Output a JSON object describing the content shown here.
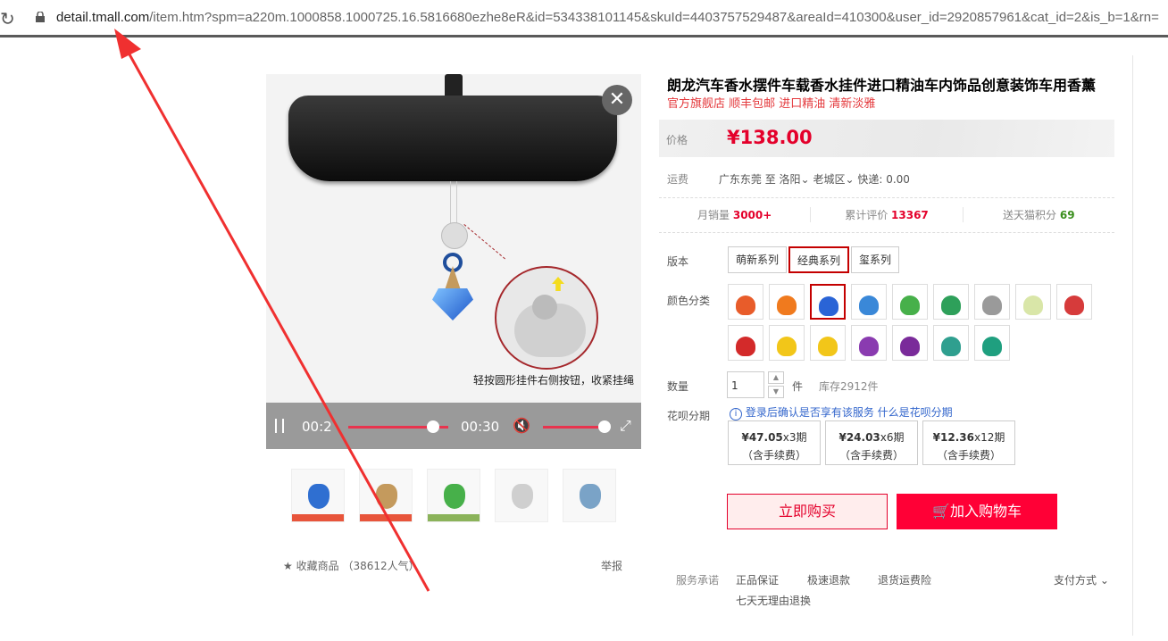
{
  "browser": {
    "url_host": "detail.tmall.com",
    "url_rest": "/item.htm?spm=a220m.1000858.1000725.16.5816680ezhe8eR&id=534338101145&skuId=4403757529487&areaId=410300&user_id=2920857961&cat_id=2&is_b=1&rn="
  },
  "video": {
    "caption": "轻按圆形挂件右侧按钮，收紧挂绳",
    "time_current": "00:2",
    "time_total": "00:30",
    "close_glyph": "✕"
  },
  "gallery": {
    "favorite_label": "收藏商品",
    "favorite_count": "（38612人气）",
    "report_label": "举报"
  },
  "product": {
    "title": "朗龙汽车香水摆件车载香水挂件进口精油车内饰品创意装饰车用香薰",
    "subtitle": "官方旗舰店 顺丰包邮 进口精油 清新淡雅",
    "price_label": "价格",
    "price": "¥138.00",
    "shipping_label": "运费",
    "shipping_from": "广东东莞",
    "shipping_to_word": "至",
    "shipping_city": "洛阳",
    "shipping_district": "老城区",
    "shipping_express": "快递: 0.00",
    "stats": [
      {
        "label": "月销量",
        "value": "3000+",
        "color": "#e4002b"
      },
      {
        "label": "累计评价",
        "value": "13367",
        "color": "#e4002b"
      },
      {
        "label": "送天猫积分",
        "value": "69",
        "color": "#3a8f1d"
      }
    ],
    "version_label": "版本",
    "versions": [
      "萌新系列",
      "经典系列",
      "玺系列"
    ],
    "selected_version": "经典系列",
    "color_label": "颜色分类",
    "swatch_colors": [
      "#e85c2a",
      "#f07a1e",
      "#2a64d6",
      "#3a88d8",
      "#47b04a",
      "#2ea05a",
      "#9a9a9a",
      "#d9e6a8",
      "#d63b3b",
      "#d32a2a",
      "#f2c619",
      "#f2c619",
      "#8a3bb0",
      "#7a2b9a",
      "#2f9f8f",
      "#1f9f7f"
    ],
    "quantity_label": "数量",
    "quantity_value": "1",
    "quantity_unit": "件",
    "stock": "库存2912件",
    "huabei_label": "花呗分期",
    "huabei_notice": "登录后确认是否享有该服务",
    "huabei_link": "什么是花呗分期",
    "installments": [
      {
        "amount": "¥47.05",
        "term": "x3期",
        "fee": "（含手续费）"
      },
      {
        "amount": "¥24.03",
        "term": "x6期",
        "fee": "（含手续费）"
      },
      {
        "amount": "¥12.36",
        "term": "x12期",
        "fee": "（含手续费）"
      }
    ],
    "buy_now": "立即购买",
    "add_to_cart": "加入购物车",
    "service_label": "服务承诺",
    "services": [
      "正品保证",
      "极速退款",
      "退货运费险"
    ],
    "service_extra": "七天无理由退换",
    "payment_label": "支付方式"
  }
}
